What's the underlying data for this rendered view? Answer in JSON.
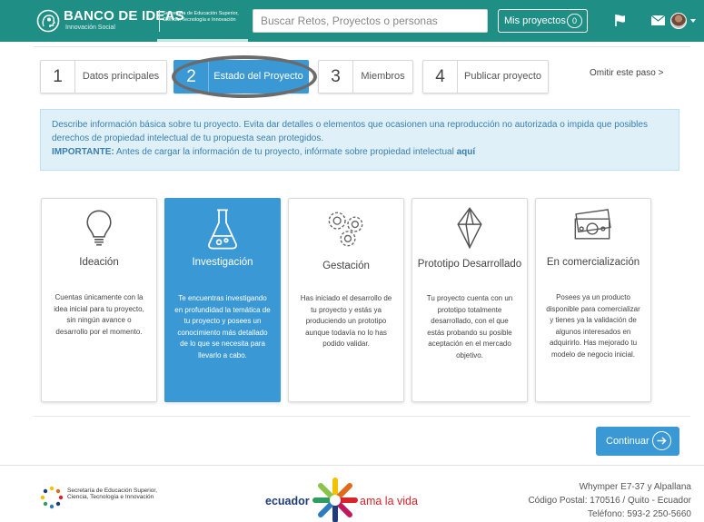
{
  "header": {
    "logo_title": "BANCO DE IDEAS",
    "logo_subtitle": "Innovación Social",
    "logo_org": "Secretaría de Educación Superior, Ciencia, Tecnología e Innovación",
    "search_placeholder": "Buscar Retos, Proyectos o personas",
    "my_projects_label": "Mis proyectos",
    "my_projects_count": "0",
    "icons": [
      "flag-icon",
      "mail-icon"
    ],
    "brand_color": "#1f8f86"
  },
  "steps": [
    {
      "number": "1",
      "label": "Datos principales",
      "active": false
    },
    {
      "number": "2",
      "label": "Estado del Proyecto",
      "active": true
    },
    {
      "number": "3",
      "label": "Miembros",
      "active": false
    },
    {
      "number": "4",
      "label": "Publicar proyecto",
      "active": false
    }
  ],
  "skip_step": "Omitir este paso >",
  "info": {
    "text": "Describe información básica sobre tu proyecto. Evita dar detalles o elementos que ocasionen una reproducción no autorizada o impida que posibles derechos de propiedad intelectual de tu propuesta sean protegidos.",
    "important_label": "IMPORTANTE:",
    "important_text": " Antes de cargar la información de tu proyecto, infórmate sobre propiedad intelectual ",
    "important_link": "aquí"
  },
  "stages": [
    {
      "title": "Ideación",
      "icon": "lightbulb-icon",
      "active": false,
      "description": "Cuentas únicamente con la idea inicial para tu proyecto, sin ningún avance o desarrollo por el momento."
    },
    {
      "title": "Investigación",
      "icon": "flask-icon",
      "active": true,
      "description": "Te encuentras investigando en profundidad la temática de tu proyecto y posees un conocimiento más detallado de lo que se necesita para llevarlo a cabo."
    },
    {
      "title": "Gestación",
      "icon": "gears-icon",
      "active": false,
      "description": "Has iniciado el desarrollo de tu proyecto y estás ya produciendo un prototipo aunque todavía no lo has podido validar."
    },
    {
      "title": "Prototipo Desarrollado",
      "icon": "diamond-icon",
      "active": false,
      "description": "Tu proyecto cuenta con un prototipo totalmente desarrollado, con el que estás probando su posible aceptación en el mercado objetivo."
    },
    {
      "title": "En comercialización",
      "icon": "money-icon",
      "active": false,
      "description": "Posees ya un producto disponible para comercializar y tienes ya la validación de algunos interesados en adquirirlo. Has mejorado tu modelo de negocio inicial."
    }
  ],
  "continue_label": "Continuar",
  "accent_color": "#3a98d4",
  "footer": {
    "org": "Secretaría de Educación Superior, Ciencia, Tecnología e Innovación",
    "ecuador": "ecuador",
    "slogan": "ama la vida",
    "address": "Whymper E7-37 y Alpallana",
    "postal": "Código Postal: 170516 / Quito - Ecuador",
    "phone": "Teléfono: 593-2 250-5660"
  }
}
